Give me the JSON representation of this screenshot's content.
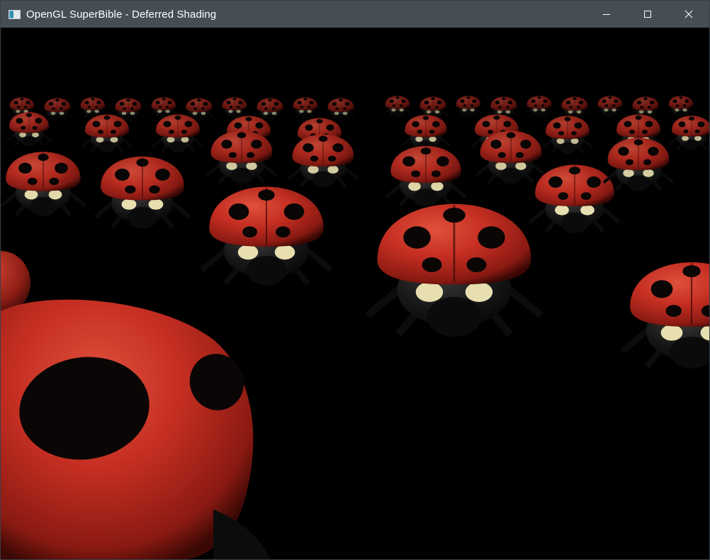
{
  "window": {
    "title": "OpenGL SuperBible - Deferred Shading",
    "app_icon": "window-app-icon",
    "controls": {
      "minimize_icon": "minimize-icon",
      "maximize_icon": "maximize-icon",
      "close_icon": "close-icon"
    }
  },
  "scene": {
    "description_icon": "rendered-3d-scene",
    "subject": "ladybug-instances",
    "colors": {
      "background": "#000000",
      "shell_red": "#c42e22",
      "shell_spot": "#0a0606",
      "body_black": "#141414",
      "pale_marking": "#e8dfb0",
      "titlebar": "#454d55"
    }
  }
}
